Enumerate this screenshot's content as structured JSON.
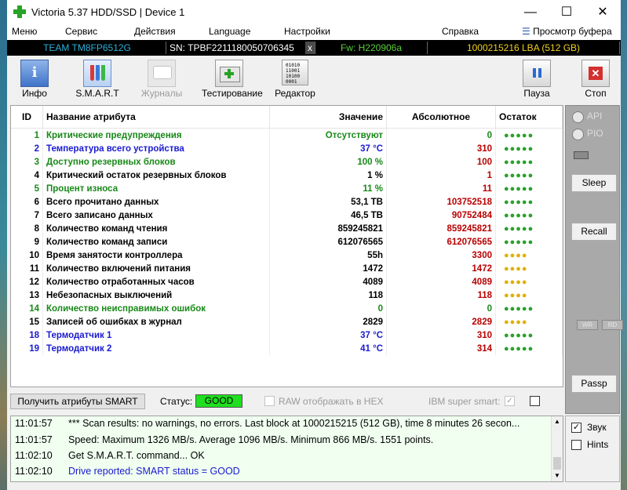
{
  "window": {
    "title": "Victoria 5.37 HDD/SSD | Device 1",
    "minimize": "—",
    "maximize": "☐",
    "close": "✕"
  },
  "menu": [
    "Меню",
    "Сервис",
    "Действия",
    "Language",
    "Настройки",
    "Справка"
  ],
  "menu_extra": "Просмотр буфера",
  "device": {
    "model": "TEAM TM8FP6512G",
    "serial": "SN: TPBF2211180050706345",
    "x": "x",
    "firmware": "Fw: H220906a",
    "lba": "1000215216 LBA (512 GB)"
  },
  "toolbar": {
    "info": "Инфо",
    "smart": "S.M.A.R.T",
    "logs": "Журналы",
    "test": "Тестирование",
    "editor": "Редактор",
    "pause": "Пауза",
    "stop": "Стоп"
  },
  "editor_icon_text": [
    "01010",
    "11001",
    "10100",
    "0001"
  ],
  "smart_table": {
    "headers": [
      "ID",
      "Название атрибута",
      "Значение",
      "Абсолютное",
      "Остаток"
    ],
    "rows": [
      {
        "id": "1",
        "name": "Критические предупреждения",
        "value": "Отсутствуют",
        "abs": "0",
        "dots": "●●●●●",
        "nc": "c-green",
        "vc": "c-green",
        "ac": "c-green",
        "dc": "#2aa02a"
      },
      {
        "id": "2",
        "name": "Температура всего устройства",
        "value": "37 °C",
        "abs": "310",
        "dots": "●●●●●",
        "nc": "c-blue",
        "vc": "c-blue",
        "ac": "c-red",
        "dc": "#2aa02a"
      },
      {
        "id": "3",
        "name": "Доступно резервных блоков",
        "value": "100 %",
        "abs": "100",
        "dots": "●●●●●",
        "nc": "c-green",
        "vc": "c-green",
        "ac": "c-red",
        "dc": "#2aa02a"
      },
      {
        "id": "4",
        "name": "Критический остаток резервных блоков",
        "value": "1 %",
        "abs": "1",
        "dots": "●●●●●",
        "nc": "c-black",
        "vc": "c-black",
        "ac": "c-red",
        "dc": "#2aa02a"
      },
      {
        "id": "5",
        "name": "Процент износа",
        "value": "11 %",
        "abs": "11",
        "dots": "●●●●●",
        "nc": "c-green",
        "vc": "c-green",
        "ac": "c-red",
        "dc": "#2aa02a"
      },
      {
        "id": "6",
        "name": "Всего прочитано данных",
        "value": "53,1 TB",
        "abs": "103752518",
        "dots": "●●●●●",
        "nc": "c-black",
        "vc": "c-black",
        "ac": "c-red",
        "dc": "#2aa02a"
      },
      {
        "id": "7",
        "name": "Всего записано данных",
        "value": "46,5 TB",
        "abs": "90752484",
        "dots": "●●●●●",
        "nc": "c-black",
        "vc": "c-black",
        "ac": "c-red",
        "dc": "#2aa02a"
      },
      {
        "id": "8",
        "name": "Количество команд чтения",
        "value": "859245821",
        "abs": "859245821",
        "dots": "●●●●●",
        "nc": "c-black",
        "vc": "c-black",
        "ac": "c-red",
        "dc": "#2aa02a"
      },
      {
        "id": "9",
        "name": "Количество команд записи",
        "value": "612076565",
        "abs": "612076565",
        "dots": "●●●●●",
        "nc": "c-black",
        "vc": "c-black",
        "ac": "c-red",
        "dc": "#2aa02a"
      },
      {
        "id": "10",
        "name": "Время занятости контроллера",
        "value": "55h",
        "abs": "3300",
        "dots": "●●●●",
        "nc": "c-black",
        "vc": "c-black",
        "ac": "c-red",
        "dc": "#e0b000"
      },
      {
        "id": "11",
        "name": "Количество включений питания",
        "value": "1472",
        "abs": "1472",
        "dots": "●●●●",
        "nc": "c-black",
        "vc": "c-black",
        "ac": "c-red",
        "dc": "#e0b000"
      },
      {
        "id": "12",
        "name": "Количество отработанных часов",
        "value": "4089",
        "abs": "4089",
        "dots": "●●●●",
        "nc": "c-black",
        "vc": "c-black",
        "ac": "c-red",
        "dc": "#e0b000"
      },
      {
        "id": "13",
        "name": "Небезопасных выключений",
        "value": "118",
        "abs": "118",
        "dots": "●●●●",
        "nc": "c-black",
        "vc": "c-black",
        "ac": "c-red",
        "dc": "#e0b000"
      },
      {
        "id": "14",
        "name": "Количество неисправимых ошибок",
        "value": "0",
        "abs": "0",
        "dots": "●●●●●",
        "nc": "c-green",
        "vc": "c-green",
        "ac": "c-green",
        "dc": "#2aa02a"
      },
      {
        "id": "15",
        "name": "Записей об ошибках в журнал",
        "value": "2829",
        "abs": "2829",
        "dots": "●●●●",
        "nc": "c-black",
        "vc": "c-black",
        "ac": "c-red",
        "dc": "#e0b000"
      },
      {
        "id": "18",
        "name": "Термодатчик 1",
        "value": "37 °C",
        "abs": "310",
        "dots": "●●●●●",
        "nc": "c-blue",
        "vc": "c-blue",
        "ac": "c-red",
        "dc": "#2aa02a"
      },
      {
        "id": "19",
        "name": "Термодатчик 2",
        "value": "41 °C",
        "abs": "314",
        "dots": "●●●●●",
        "nc": "c-blue",
        "vc": "c-blue",
        "ac": "c-red",
        "dc": "#2aa02a"
      }
    ]
  },
  "side": {
    "api": "API",
    "pio": "PIO",
    "sleep": "Sleep",
    "recall": "Recall",
    "wr": "WR",
    "rd": "RD",
    "passp": "Passp"
  },
  "status_row": {
    "get_button": "Получить атрибуты SMART",
    "status_label": "Статус:",
    "status_value": "GOOD",
    "raw_hex": "RAW отображать в HEX",
    "ibm": "IBM super smart:",
    "ibm_check": "✓"
  },
  "log": [
    {
      "time": "11:01:57",
      "msg": "*** Scan results: no warnings, no errors. Last block at 1000215215 (512 GB), time 8 minutes 26 secon...",
      "color": "#000"
    },
    {
      "time": "11:01:57",
      "msg": "Speed: Maximum 1326 MB/s. Average 1096 MB/s. Minimum 866 MB/s. 1551 points.",
      "color": "#000"
    },
    {
      "time": "11:02:10",
      "msg": "Get S.M.A.R.T. command... OK",
      "color": "#000"
    },
    {
      "time": "11:02:10",
      "msg": "Drive reported: SMART status = GOOD",
      "color": "#1a1ad0"
    }
  ],
  "bottom_right": {
    "sound": "Звук",
    "hints": "Hints",
    "sound_check": "✓"
  }
}
